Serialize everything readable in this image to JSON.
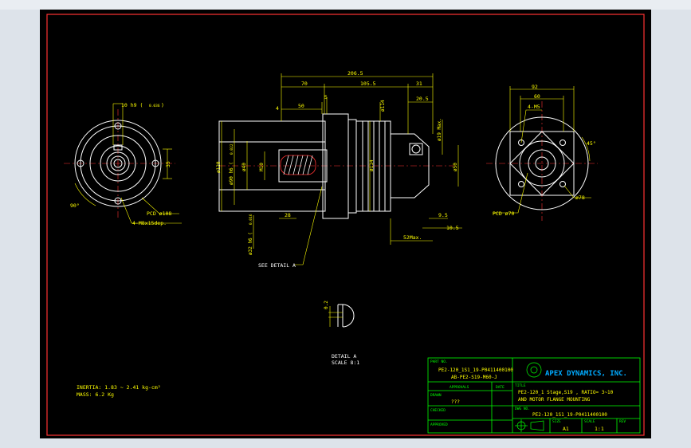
{
  "colors": {
    "background": "#000000",
    "frame": "#ff3333",
    "geometry": "#ffffff",
    "dimension": "#ffff00",
    "title_block": "#00ff00",
    "center_line": "#ff3333",
    "hatch": "#ffffff"
  },
  "left_view": {
    "dim_top": "10 h9 (",
    "dim_top_sub": "0.036",
    "dim_top_close": ")",
    "dim_right": "35",
    "pcd_label": "PCD ø108",
    "holes_label": "4-M8x15dep.",
    "angle": "90°"
  },
  "front_view": {
    "dim_overall": "206.5",
    "dim_70": "70",
    "dim_1055": "105.5",
    "dim_31": "31",
    "dim_50": "50",
    "dim_4": "4",
    "dim_5": "5",
    "dim_14": "ø114",
    "dim_205": "20.5",
    "dim_d120": "ø120",
    "dim_d90": "ø90 h6 (",
    "dim_d90_sub": "0.022",
    "dim_d40": "ø40",
    "dim_m10": "M10",
    "dim_d114": "ø114",
    "dim_d50": "ø50",
    "dim_d19": "ø19 Max.",
    "dim_28": "28",
    "dim_d32": "ø32 h6 (",
    "dim_d32_sub": "0.016",
    "dim_95": "9.5",
    "dim_105": "10.5",
    "dim_52max": "52Max.",
    "see_detail": "SEE DETAIL A"
  },
  "right_view": {
    "dim_92": "92",
    "dim_60": "60",
    "dim_4n5": "4-M5",
    "angle": "45°",
    "pcd_label": "PCD ø70",
    "hole_label": "ø78"
  },
  "detail": {
    "dim": "0.2",
    "label_1": "DETAIL A",
    "label_2": "SCALE 8:1"
  },
  "notes": {
    "inertia": "INERTIA: 1.83 ~ 2.41 kg-cm²",
    "mass": "MASS: 6.2  Kg"
  },
  "title_block": {
    "part_no_label": "PART NO.",
    "part_no_1": "PE2-120_1S1_19-P0411400100",
    "part_no_2": "AB-PE2-S19-M60-J",
    "approvals_label": "APPROVALS",
    "date_label": "DATE",
    "drawn_label": "DRAWN",
    "drawn_value": "???",
    "checked_label": "CHECKED",
    "approved_label": "APPROVED",
    "company": "APEX DYNAMICS, INC.",
    "title_label": "TITLE",
    "title_1": "PE2-120_1 Stage,S19 , RATIO= 3~10",
    "title_2": "AND MOTOR FLANGE MOUNTING",
    "dwg_label": "DWG NO.",
    "dwg_value": "PE2-120_1S1_19-P0411400100",
    "size_label": "SIZE",
    "size_value": "A1",
    "scale_label": "SCALE",
    "scale_value": "1:1",
    "rev_label": "REV"
  }
}
